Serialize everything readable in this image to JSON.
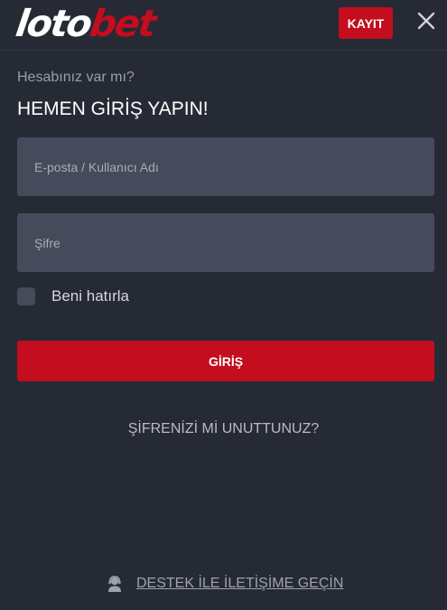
{
  "header": {
    "logo_part1": "loto",
    "logo_part2": "bet",
    "register_label": "KAYIT",
    "close_icon": "close-icon"
  },
  "login": {
    "subtitle": "Hesabınız var mı?",
    "title": "HEMEN GİRİŞ YAPIN!",
    "email_placeholder": "E-posta / Kullanıcı Adı",
    "email_value": "",
    "password_placeholder": "Şifre",
    "password_value": "",
    "remember_label": "Beni hatırla",
    "remember_checked": false,
    "submit_label": "GİRİŞ",
    "forgot_label": "ŞİFRENİZİ Mİ UNUTTUNUZ?"
  },
  "support": {
    "icon": "support-agent-icon",
    "label": "DESTEK İLE İLETİŞİME GEÇİN"
  },
  "colors": {
    "background": "#262a35",
    "input_background": "#464a5a",
    "accent": "#c40d1e",
    "text": "#ffffff",
    "muted_text": "#9a9ea8"
  }
}
